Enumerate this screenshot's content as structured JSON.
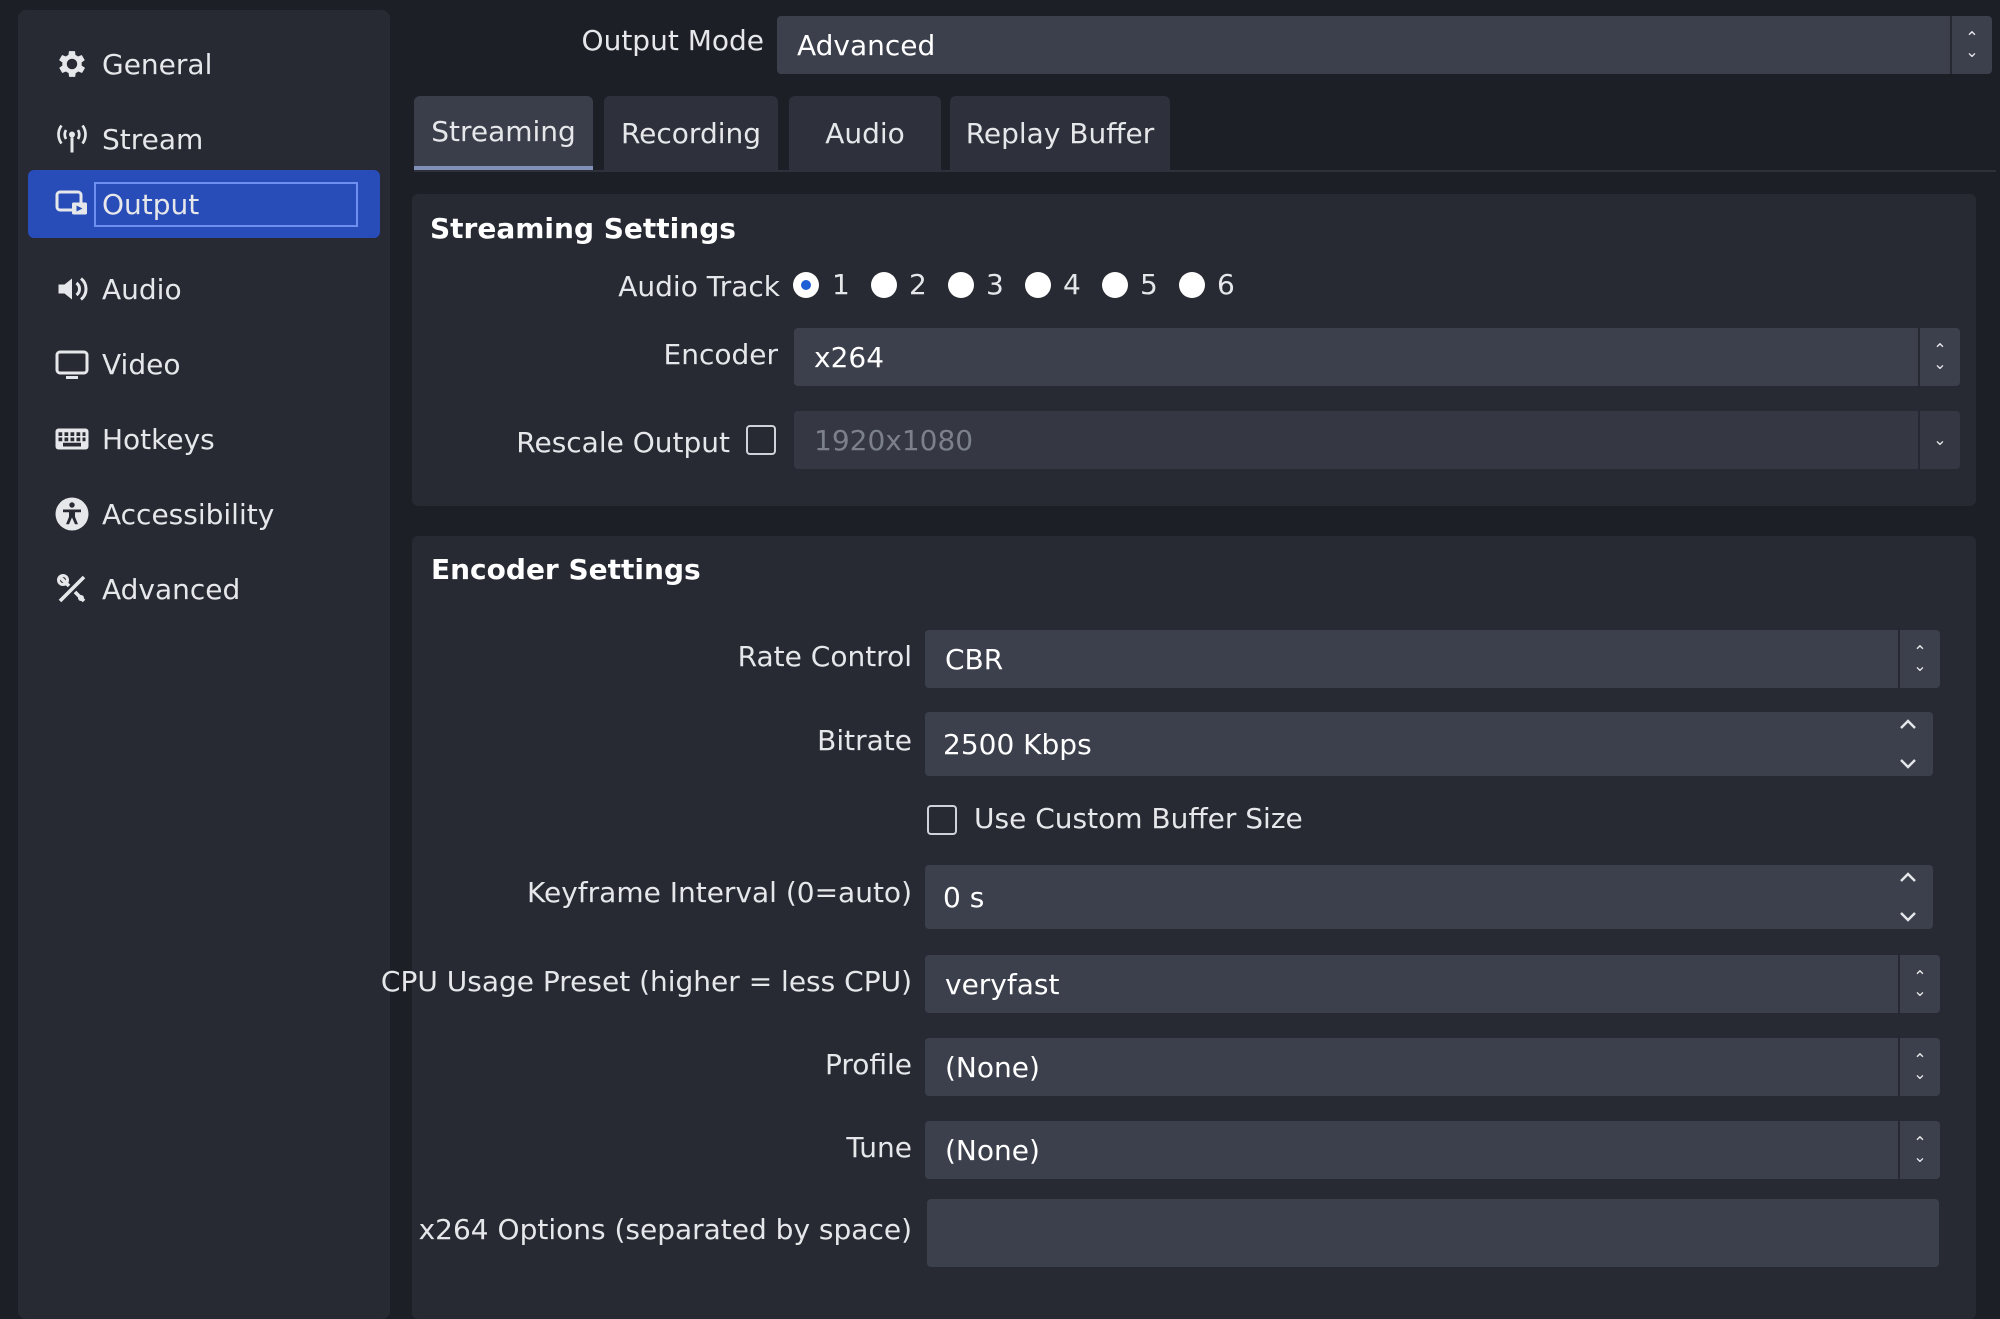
{
  "sidebar": {
    "items": [
      {
        "label": "General",
        "icon": "gear-icon"
      },
      {
        "label": "Stream",
        "icon": "antenna-icon"
      },
      {
        "label": "Output",
        "icon": "output-icon",
        "active": true
      },
      {
        "label": "Audio",
        "icon": "speaker-icon"
      },
      {
        "label": "Video",
        "icon": "monitor-icon"
      },
      {
        "label": "Hotkeys",
        "icon": "keyboard-icon"
      },
      {
        "label": "Accessibility",
        "icon": "accessibility-icon"
      },
      {
        "label": "Advanced",
        "icon": "tools-icon"
      }
    ]
  },
  "output_mode": {
    "label": "Output Mode",
    "value": "Advanced"
  },
  "tabs": [
    {
      "label": "Streaming",
      "active": true
    },
    {
      "label": "Recording"
    },
    {
      "label": "Audio"
    },
    {
      "label": "Replay Buffer"
    }
  ],
  "streaming_settings": {
    "title": "Streaming Settings",
    "audio_track_label": "Audio Track",
    "tracks": [
      "1",
      "2",
      "3",
      "4",
      "5",
      "6"
    ],
    "selected_track": "1",
    "encoder_label": "Encoder",
    "encoder_value": "x264",
    "rescale_label": "Rescale Output",
    "rescale_value": "1920x1080"
  },
  "encoder_settings": {
    "title": "Encoder Settings",
    "rate_control_label": "Rate Control",
    "rate_control_value": "CBR",
    "bitrate_label": "Bitrate",
    "bitrate_value": "2500 Kbps",
    "custom_buffer_label": "Use Custom Buffer Size",
    "keyframe_label": "Keyframe Interval (0=auto)",
    "keyframe_value": "0 s",
    "cpu_preset_label": "CPU Usage Preset (higher = less CPU)",
    "cpu_preset_value": "veryfast",
    "profile_label": "Profile",
    "profile_value": "(None)",
    "tune_label": "Tune",
    "tune_value": "(None)",
    "x264_options_label": "x264 Options (separated by space)",
    "x264_options_value": ""
  },
  "colors": {
    "accent": "#284cb8",
    "radio_checked": "#1f5fd6",
    "background": "#1d1f26"
  }
}
